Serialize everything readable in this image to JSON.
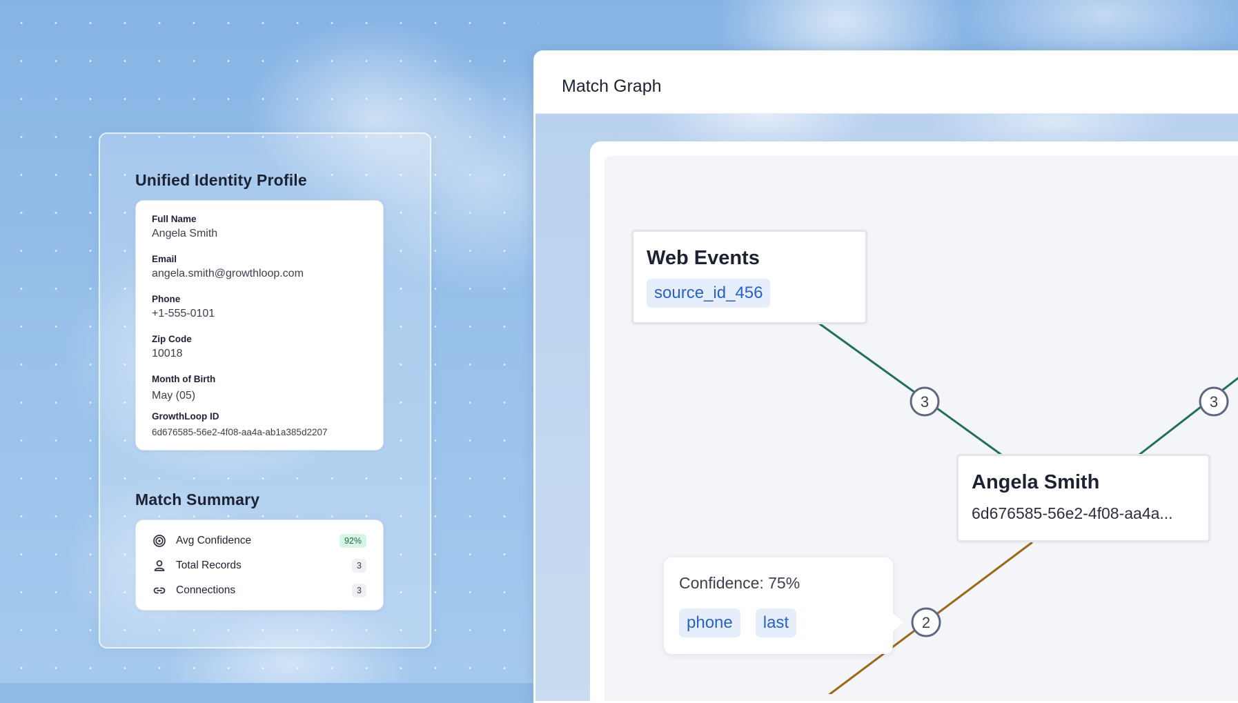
{
  "profile": {
    "title": "Unified Identity Profile",
    "fields": [
      {
        "label": "Full Name",
        "value": "Angela Smith"
      },
      {
        "label": "Email",
        "value": "angela.smith@growthloop.com"
      },
      {
        "label": "Phone",
        "value": "+1-555-0101"
      },
      {
        "label": "Zip Code",
        "value": "10018"
      },
      {
        "label": "Month of Birth",
        "value": "May (05)"
      },
      {
        "label": "GrowthLoop ID",
        "value": "6d676585-56e2-4f08-aa4a-ab1a385d2207"
      }
    ]
  },
  "summary": {
    "title": "Match Summary",
    "rows": [
      {
        "icon": "target-icon",
        "label": "Avg Confidence",
        "value": "92%"
      },
      {
        "icon": "user-icon",
        "label": "Total Records",
        "value": "3"
      },
      {
        "icon": "link-icon",
        "label": "Connections",
        "value": "3"
      }
    ]
  },
  "graph": {
    "title": "Match Graph",
    "source_node": {
      "title": "Web Events",
      "tag": "source_id_456"
    },
    "identity_node": {
      "title": "Angela Smith",
      "id": "6d676585-56e2-4f08-aa4a..."
    },
    "edge_badges": [
      "3",
      "3",
      "2"
    ],
    "tooltip": {
      "text": "Confidence: 75%",
      "tags": [
        "phone",
        "last"
      ]
    },
    "colors": {
      "green_edge": "#1e6f5c",
      "brown_edge": "#9c6618",
      "badge_ring": "#5e6680",
      "tag_text": "#2662c9"
    }
  }
}
